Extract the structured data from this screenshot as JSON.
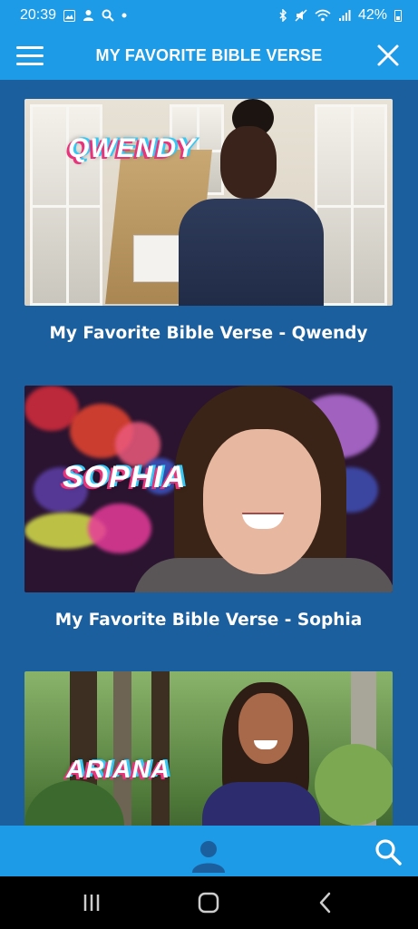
{
  "status_bar": {
    "time": "20:39",
    "battery": "42%",
    "icons": [
      "gallery-icon",
      "notification-icon",
      "search-icon",
      "dot-icon",
      "bluetooth-icon",
      "mute-icon",
      "wifi-icon",
      "signal-icon",
      "battery-icon"
    ]
  },
  "header": {
    "title": "MY FAVORITE BIBLE VERSE",
    "menu_icon": "hamburger-icon",
    "close_icon": "close-icon"
  },
  "videos": [
    {
      "thumb_name": "QWENDY",
      "title": "My Favorite Bible Verse - Qwendy"
    },
    {
      "thumb_name": "SOPHIA",
      "title": "My Favorite Bible Verse - Sophia"
    },
    {
      "thumb_name": "ARIANA",
      "title": ""
    }
  ],
  "bottom_bar": {
    "profile_icon": "profile-icon",
    "search_icon": "search-icon"
  },
  "system_nav": {
    "icons": [
      "recent-apps-icon",
      "home-icon",
      "back-icon"
    ]
  },
  "colors": {
    "accent": "#1d9be6",
    "background": "#1b5f9e"
  }
}
